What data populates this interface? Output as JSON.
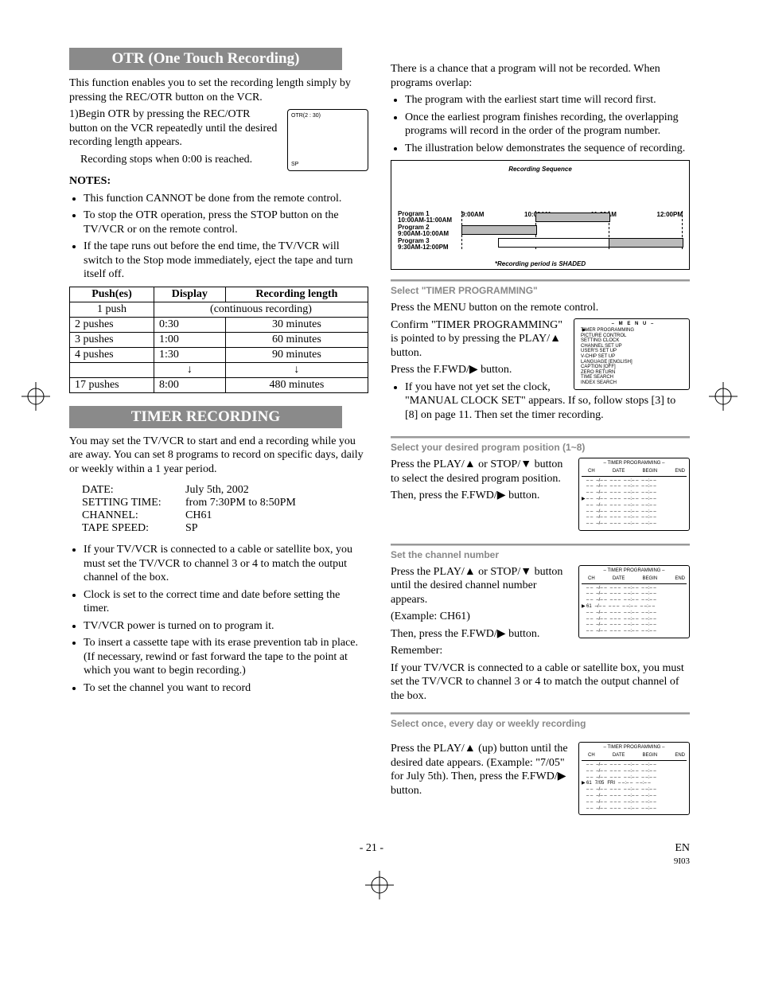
{
  "page_number": "- 21 -",
  "lang_code": "EN",
  "rev_code": "9I03",
  "left": {
    "otr_header": "OTR (One Touch Recording)",
    "otr_intro": "This function enables you to set the recording length simply by pressing the REC/OTR button on the VCR.",
    "otr_step1a": "1)Begin OTR by pressing the REC/OTR button on the VCR repeatedly until the desired recording length appears.",
    "otr_step1b": "Recording stops when 0:00 is reached.",
    "otr_display_top": "OTR(2 : 30)",
    "otr_display_bot": "SP",
    "notes_label": "NOTES:",
    "otr_notes": [
      "This function CANNOT be done from the remote control.",
      "To stop the OTR operation, press the STOP button on the TV/VCR or on the remote control.",
      "If the tape runs out before the end time, the TV/VCR will switch to the Stop mode immediately, eject the tape and turn itself off."
    ],
    "table_headers": {
      "pushes": "Push(es)",
      "display": "Display",
      "length": "Recording length"
    },
    "table_rows": [
      {
        "pushes": "1 push",
        "display": "",
        "length": "(continuous recording)",
        "merge": true
      },
      {
        "pushes": "2 pushes",
        "display": "0:30",
        "length": "30 minutes"
      },
      {
        "pushes": "3 pushes",
        "display": "1:00",
        "length": "60 minutes"
      },
      {
        "pushes": "4 pushes",
        "display": "1:30",
        "length": "90 minutes"
      },
      {
        "pushes": "",
        "display": "↓",
        "length": "↓",
        "arrow": true
      },
      {
        "pushes": "17 pushes",
        "display": "8:00",
        "length": "480 minutes"
      }
    ],
    "timer_header": "TIMER RECORDING",
    "timer_intro": "You may set the TV/VCR to start and end a recording while you are away. You can set 8 programs to record on specific days, daily or weekly within a 1 year period.",
    "example": {
      "date_l": "DATE:",
      "date_v": "July 5th, 2002",
      "time_l": "SETTING TIME:",
      "time_v": "from 7:30PM to 8:50PM",
      "ch_l": "CHANNEL:",
      "ch_v": "CH61",
      "speed_l": "TAPE SPEED:",
      "speed_v": "SP"
    },
    "timer_bullets": [
      "If your TV/VCR is connected to a cable or satellite box, you must set the TV/VCR to channel 3 or 4 to match the output channel of the box.",
      "Clock is set to the correct time and date before setting the timer.",
      "TV/VCR power is turned on to program it.",
      "To insert a cassette tape with its erase prevention tab in place. (If necessary, rewind or fast forward the tape to the point at which you want to begin recording.)",
      "To set the channel you want to record"
    ]
  },
  "right": {
    "overlap_intro": "There is a chance that a program will not be recorded. When programs overlap:",
    "overlap_bullets": [
      "The program with the earliest start time will record first.",
      "Once the earliest program finishes recording, the overlapping programs will record in the order of the program number.",
      "The illustration below demonstrates the sequence of recording."
    ],
    "sequence": {
      "title": "Recording Sequence",
      "programs": [
        {
          "name": "Program 1",
          "time": "10:00AM-11:00AM"
        },
        {
          "name": "Program 2",
          "time": "9:00AM-10:00AM"
        },
        {
          "name": "Program 3",
          "time": "9:30AM-12:00PM"
        }
      ],
      "xlabels": [
        "9:00AM",
        "10:00AM",
        "11:00AM",
        "12:00PM"
      ],
      "note": "*Recording period is SHADED"
    },
    "step1": {
      "head": "Select \"TIMER PROGRAMMING\"",
      "l1": "Press the MENU button on the remote control.",
      "l2": "Confirm \"TIMER PROGRAMMING\" is pointed to by pressing the PLAY/▲ button.",
      "l3": "Press the F.FWD/▶ button.",
      "bullet": "If you have not yet set the clock, \"MANUAL CLOCK SET\" appears. If so, follow stops [3] to [8] on page 11. Then set the timer recording."
    },
    "menu": {
      "title": "– M E N U –",
      "items": [
        "TIMER PROGRAMMING",
        "PICTURE CONTROL",
        "SETTING CLOCK",
        "CHANNEL SET UP",
        "USER'S SET UP",
        "V-CHIP SET UP",
        "LANGUAGE   [ENGLISH]",
        "CAPTION   [OFF]",
        "ZERO RETURN",
        "TIME SEARCH",
        "INDEX SEARCH"
      ]
    },
    "step2": {
      "head": "Select your desired program position (1~8)",
      "l1": "Press the PLAY/▲ or STOP/▼ button to select the desired program position.",
      "l2": "Then, press the F.FWD/▶ button."
    },
    "step3": {
      "head": "Set the channel number",
      "l1": "Press the PLAY/▲ or STOP/▼ button until the desired channel number appears.",
      "l2": "(Example: CH61)",
      "l3": "Then, press the F.FWD/▶ button.",
      "l4": "Remember:",
      "l5": "If your TV/VCR is connected to a cable or satellite box, you must set the TV/VCR to channel 3 or 4 to match the output channel of the box."
    },
    "step4": {
      "head": "Select once, every day or weekly recording",
      "l1": "Press the PLAY/▲ (up) button until the desired date appears. (Example: \"7/05\" for July 5th). Then, press the F.FWD/▶ button."
    },
    "prog_box": {
      "title": "– TIMER PROGRAMMING –",
      "head": {
        "ch": "CH",
        "date": "DATE",
        "begin": "BEGIN",
        "end": "END"
      }
    }
  },
  "chart_data": {
    "type": "bar",
    "title": "Recording Sequence",
    "x_axis": "time_of_day",
    "x_ticks": [
      "9:00AM",
      "10:00AM",
      "11:00AM",
      "12:00PM"
    ],
    "series": [
      {
        "name": "Program 1",
        "window": [
          "10:00AM",
          "11:00AM"
        ],
        "recorded": [
          "10:00AM",
          "11:00AM"
        ]
      },
      {
        "name": "Program 2",
        "window": [
          "9:00AM",
          "10:00AM"
        ],
        "recorded": [
          "9:00AM",
          "10:00AM"
        ]
      },
      {
        "name": "Program 3",
        "window": [
          "9:30AM",
          "12:00PM"
        ],
        "recorded": [
          "11:00AM",
          "12:00PM"
        ]
      }
    ],
    "note": "*Recording period is SHADED"
  }
}
